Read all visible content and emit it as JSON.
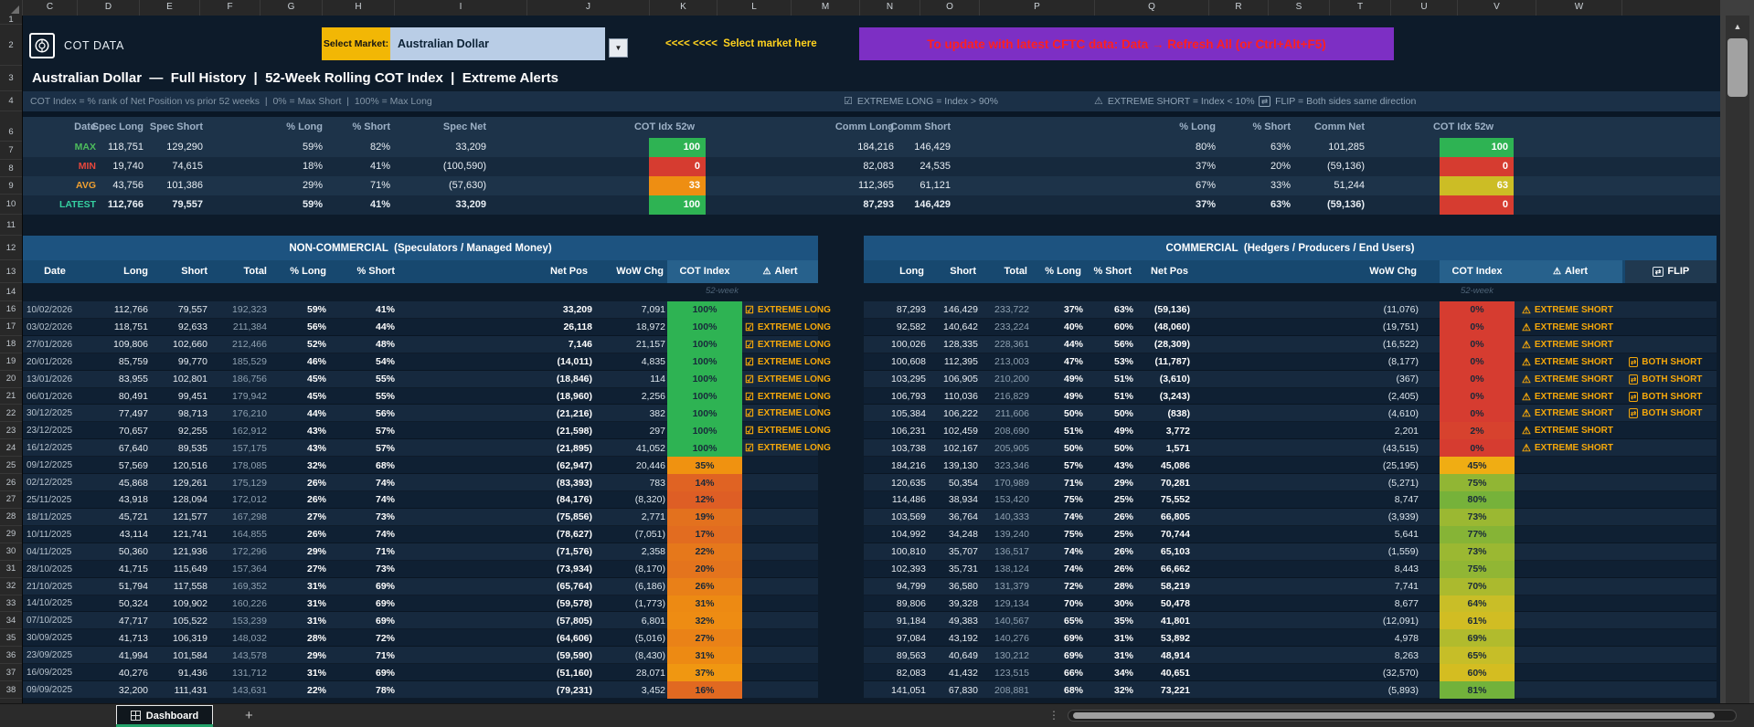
{
  "icons": {
    "dropdown": "▼",
    "scroll_up": "▲",
    "alert": "⚠",
    "check": "☑",
    "flip": "⇄"
  },
  "header": {
    "logo_text": "COT DATA",
    "select_market_label": "Select Market:",
    "selected_market": "Australian Dollar",
    "market_hint": "<<<< <<<<  Select market here",
    "refresh_banner": "To update with latest CFTC data: Data → Refresh All (or Ctrl+Alt+F5)",
    "title": "Australian Dollar  —  Full History  |  52-Week Rolling COT Index  |  Extreme Alerts",
    "subtitle": "COT Index = % rank of Net Position vs prior 52 weeks  |  0% = Max Short  |  100% = Max Long",
    "legend": [
      {
        "icon": "☑",
        "text": "EXTREME LONG = Index > 90%"
      },
      {
        "icon": "⚠",
        "text": "EXTREME SHORT = Index < 10%"
      },
      {
        "icon": "⇄",
        "text": "FLIP = Both sides same direction"
      }
    ]
  },
  "grid": {
    "columns": [
      "C",
      "D",
      "E",
      "F",
      "G",
      "H",
      "I",
      "J",
      "K",
      "L",
      "M",
      "N",
      "O",
      "P",
      "Q",
      "R",
      "S",
      "T",
      "U",
      "V",
      "W"
    ],
    "rows": [
      "1",
      "2",
      "3",
      "4",
      "6",
      "7",
      "8",
      "9",
      "10",
      "11",
      "12",
      "13",
      "14",
      "16",
      "17",
      "18",
      "19",
      "20",
      "21",
      "22",
      "23",
      "24",
      "25",
      "26",
      "27",
      "28",
      "29",
      "30",
      "31",
      "32",
      "33",
      "34",
      "35",
      "36",
      "37",
      "38"
    ]
  },
  "summary": {
    "left_headers": [
      "Date",
      "Spec Long",
      "Spec Short",
      "% Long",
      "% Short",
      "Spec Net",
      "COT Idx 52w"
    ],
    "right_headers": [
      "Comm Long",
      "Comm Short",
      "% Long",
      "% Short",
      "Comm Net",
      "COT Idx 52w"
    ],
    "rows": [
      {
        "label": "MAX",
        "color": "#4dbd5c",
        "bold": false,
        "spec": [
          "118,751",
          "129,290",
          "59%",
          "82%",
          "33,209"
        ],
        "spec_idx": "100",
        "spec_idx_v": 100,
        "comm": [
          "184,216",
          "146,429",
          "80%",
          "63%",
          "101,285"
        ],
        "comm_idx": "100",
        "comm_idx_v": 100
      },
      {
        "label": "MIN",
        "color": "#e8473c",
        "bold": false,
        "spec": [
          "19,740",
          "74,615",
          "18%",
          "41%",
          "(100,590)"
        ],
        "spec_idx": "0",
        "spec_idx_v": 0,
        "comm": [
          "82,083",
          "24,535",
          "37%",
          "20%",
          "(59,136)"
        ],
        "comm_idx": "0",
        "comm_idx_v": 0
      },
      {
        "label": "AVG",
        "color": "#f0a030",
        "bold": false,
        "spec": [
          "43,756",
          "101,386",
          "29%",
          "71%",
          "(57,630)"
        ],
        "spec_idx": "33",
        "spec_idx_v": 33,
        "comm": [
          "112,365",
          "61,121",
          "67%",
          "33%",
          "51,244"
        ],
        "comm_idx": "63",
        "comm_idx_v": 63
      },
      {
        "label": "LATEST",
        "color": "#35d0a0",
        "bold": true,
        "spec": [
          "112,766",
          "79,557",
          "59%",
          "41%",
          "33,209"
        ],
        "spec_idx": "100",
        "spec_idx_v": 100,
        "comm": [
          "87,293",
          "146,429",
          "37%",
          "63%",
          "(59,136)"
        ],
        "comm_idx": "0",
        "comm_idx_v": 0
      }
    ]
  },
  "noncommercial": {
    "title": "NON-COMMERCIAL  (Speculators / Managed Money)",
    "headers": {
      "date": "Date",
      "long": "Long",
      "short": "Short",
      "total": "Total",
      "pct_long": "% Long",
      "pct_short": "% Short",
      "net": "Net Pos",
      "wow": "WoW Chg",
      "idx": "COT Index",
      "alert": "Alert"
    },
    "subnote": "52-week",
    "rows": [
      [
        "10/02/2026",
        "112,766",
        "79,557",
        "192,323",
        "59%",
        "41%",
        "33,209",
        "7,091",
        "100%",
        100,
        "EXTREME LONG"
      ],
      [
        "03/02/2026",
        "118,751",
        "92,633",
        "211,384",
        "56%",
        "44%",
        "26,118",
        "18,972",
        "100%",
        100,
        "EXTREME LONG"
      ],
      [
        "27/01/2026",
        "109,806",
        "102,660",
        "212,466",
        "52%",
        "48%",
        "7,146",
        "21,157",
        "100%",
        100,
        "EXTREME LONG"
      ],
      [
        "20/01/2026",
        "85,759",
        "99,770",
        "185,529",
        "46%",
        "54%",
        "(14,011)",
        "4,835",
        "100%",
        100,
        "EXTREME LONG"
      ],
      [
        "13/01/2026",
        "83,955",
        "102,801",
        "186,756",
        "45%",
        "55%",
        "(18,846)",
        "114",
        "100%",
        100,
        "EXTREME LONG"
      ],
      [
        "06/01/2026",
        "80,491",
        "99,451",
        "179,942",
        "45%",
        "55%",
        "(18,960)",
        "2,256",
        "100%",
        100,
        "EXTREME LONG"
      ],
      [
        "30/12/2025",
        "77,497",
        "98,713",
        "176,210",
        "44%",
        "56%",
        "(21,216)",
        "382",
        "100%",
        100,
        "EXTREME LONG"
      ],
      [
        "23/12/2025",
        "70,657",
        "92,255",
        "162,912",
        "43%",
        "57%",
        "(21,598)",
        "297",
        "100%",
        100,
        "EXTREME LONG"
      ],
      [
        "16/12/2025",
        "67,640",
        "89,535",
        "157,175",
        "43%",
        "57%",
        "(21,895)",
        "41,052",
        "100%",
        100,
        "EXTREME LONG"
      ],
      [
        "09/12/2025",
        "57,569",
        "120,516",
        "178,085",
        "32%",
        "68%",
        "(62,947)",
        "20,446",
        "35%",
        35,
        ""
      ],
      [
        "02/12/2025",
        "45,868",
        "129,261",
        "175,129",
        "26%",
        "74%",
        "(83,393)",
        "783",
        "14%",
        14,
        ""
      ],
      [
        "25/11/2025",
        "43,918",
        "128,094",
        "172,012",
        "26%",
        "74%",
        "(84,176)",
        "(8,320)",
        "12%",
        12,
        ""
      ],
      [
        "18/11/2025",
        "45,721",
        "121,577",
        "167,298",
        "27%",
        "73%",
        "(75,856)",
        "2,771",
        "19%",
        19,
        ""
      ],
      [
        "10/11/2025",
        "43,114",
        "121,741",
        "164,855",
        "26%",
        "74%",
        "(78,627)",
        "(7,051)",
        "17%",
        17,
        ""
      ],
      [
        "04/11/2025",
        "50,360",
        "121,936",
        "172,296",
        "29%",
        "71%",
        "(71,576)",
        "2,358",
        "22%",
        22,
        ""
      ],
      [
        "28/10/2025",
        "41,715",
        "115,649",
        "157,364",
        "27%",
        "73%",
        "(73,934)",
        "(8,170)",
        "20%",
        20,
        ""
      ],
      [
        "21/10/2025",
        "51,794",
        "117,558",
        "169,352",
        "31%",
        "69%",
        "(65,764)",
        "(6,186)",
        "26%",
        26,
        ""
      ],
      [
        "14/10/2025",
        "50,324",
        "109,902",
        "160,226",
        "31%",
        "69%",
        "(59,578)",
        "(1,773)",
        "31%",
        31,
        ""
      ],
      [
        "07/10/2025",
        "47,717",
        "105,522",
        "153,239",
        "31%",
        "69%",
        "(57,805)",
        "6,801",
        "32%",
        32,
        ""
      ],
      [
        "30/09/2025",
        "41,713",
        "106,319",
        "148,032",
        "28%",
        "72%",
        "(64,606)",
        "(5,016)",
        "27%",
        27,
        ""
      ],
      [
        "23/09/2025",
        "41,994",
        "101,584",
        "143,578",
        "29%",
        "71%",
        "(59,590)",
        "(8,430)",
        "31%",
        31,
        ""
      ],
      [
        "16/09/2025",
        "40,276",
        "91,436",
        "131,712",
        "31%",
        "69%",
        "(51,160)",
        "28,071",
        "37%",
        37,
        ""
      ],
      [
        "09/09/2025",
        "32,200",
        "111,431",
        "143,631",
        "22%",
        "78%",
        "(79,231)",
        "3,452",
        "16%",
        16,
        ""
      ]
    ]
  },
  "commercial": {
    "title": "COMMERCIAL  (Hedgers / Producers / End Users)",
    "headers": {
      "long": "Long",
      "short": "Short",
      "total": "Total",
      "pct_long": "% Long",
      "pct_short": "% Short",
      "net": "Net Pos",
      "wow": "WoW Chg",
      "idx": "COT Index",
      "alert": "Alert",
      "flip": "FLIP"
    },
    "subnote": "52-week",
    "rows": [
      [
        "87,293",
        "146,429",
        "233,722",
        "37%",
        "63%",
        "(59,136)",
        "(11,076)",
        "0%",
        0,
        "EXTREME SHORT",
        ""
      ],
      [
        "92,582",
        "140,642",
        "233,224",
        "40%",
        "60%",
        "(48,060)",
        "(19,751)",
        "0%",
        0,
        "EXTREME SHORT",
        ""
      ],
      [
        "100,026",
        "128,335",
        "228,361",
        "44%",
        "56%",
        "(28,309)",
        "(16,522)",
        "0%",
        0,
        "EXTREME SHORT",
        ""
      ],
      [
        "100,608",
        "112,395",
        "213,003",
        "47%",
        "53%",
        "(11,787)",
        "(8,177)",
        "0%",
        0,
        "EXTREME SHORT",
        "BOTH SHORT"
      ],
      [
        "103,295",
        "106,905",
        "210,200",
        "49%",
        "51%",
        "(3,610)",
        "(367)",
        "0%",
        0,
        "EXTREME SHORT",
        "BOTH SHORT"
      ],
      [
        "106,793",
        "110,036",
        "216,829",
        "49%",
        "51%",
        "(3,243)",
        "(2,405)",
        "0%",
        0,
        "EXTREME SHORT",
        "BOTH SHORT"
      ],
      [
        "105,384",
        "106,222",
        "211,606",
        "50%",
        "50%",
        "(838)",
        "(4,610)",
        "0%",
        0,
        "EXTREME SHORT",
        "BOTH SHORT"
      ],
      [
        "106,231",
        "102,459",
        "208,690",
        "51%",
        "49%",
        "3,772",
        "2,201",
        "2%",
        2,
        "EXTREME SHORT",
        ""
      ],
      [
        "103,738",
        "102,167",
        "205,905",
        "50%",
        "50%",
        "1,571",
        "(43,515)",
        "0%",
        0,
        "EXTREME SHORT",
        ""
      ],
      [
        "184,216",
        "139,130",
        "323,346",
        "57%",
        "43%",
        "45,086",
        "(25,195)",
        "45%",
        45,
        "",
        ""
      ],
      [
        "120,635",
        "50,354",
        "170,989",
        "71%",
        "29%",
        "70,281",
        "(5,271)",
        "75%",
        75,
        "",
        ""
      ],
      [
        "114,486",
        "38,934",
        "153,420",
        "75%",
        "25%",
        "75,552",
        "8,747",
        "80%",
        80,
        "",
        ""
      ],
      [
        "103,569",
        "36,764",
        "140,333",
        "74%",
        "26%",
        "66,805",
        "(3,939)",
        "73%",
        73,
        "",
        ""
      ],
      [
        "104,992",
        "34,248",
        "139,240",
        "75%",
        "25%",
        "70,744",
        "5,641",
        "77%",
        77,
        "",
        ""
      ],
      [
        "100,810",
        "35,707",
        "136,517",
        "74%",
        "26%",
        "65,103",
        "(1,559)",
        "73%",
        73,
        "",
        ""
      ],
      [
        "102,393",
        "35,731",
        "138,124",
        "74%",
        "26%",
        "66,662",
        "8,443",
        "75%",
        75,
        "",
        ""
      ],
      [
        "94,799",
        "36,580",
        "131,379",
        "72%",
        "28%",
        "58,219",
        "7,741",
        "70%",
        70,
        "",
        ""
      ],
      [
        "89,806",
        "39,328",
        "129,134",
        "70%",
        "30%",
        "50,478",
        "8,677",
        "64%",
        64,
        "",
        ""
      ],
      [
        "91,184",
        "49,383",
        "140,567",
        "65%",
        "35%",
        "41,801",
        "(12,091)",
        "61%",
        61,
        "",
        ""
      ],
      [
        "97,084",
        "43,192",
        "140,276",
        "69%",
        "31%",
        "53,892",
        "4,978",
        "69%",
        69,
        "",
        ""
      ],
      [
        "89,563",
        "40,649",
        "130,212",
        "69%",
        "31%",
        "48,914",
        "8,263",
        "65%",
        65,
        "",
        ""
      ],
      [
        "82,083",
        "41,432",
        "123,515",
        "66%",
        "34%",
        "40,651",
        "(32,570)",
        "60%",
        60,
        "",
        ""
      ],
      [
        "141,051",
        "67,830",
        "208,881",
        "68%",
        "32%",
        "73,221",
        "(5,893)",
        "81%",
        81,
        "",
        ""
      ]
    ]
  },
  "tabbar": {
    "active_tab": "Dashboard",
    "add_tab": "+",
    "overflow_menu": "⋮"
  }
}
